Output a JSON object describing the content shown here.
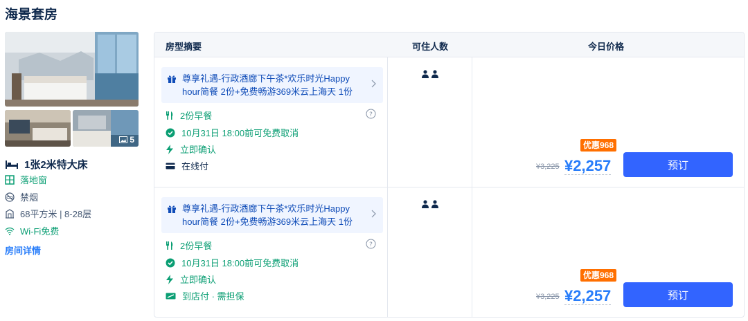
{
  "room": {
    "title": "海景套房",
    "photo_count": "5",
    "bed": "1张2米特大床",
    "facilities": {
      "window": "落地窗",
      "smoking": "禁烟",
      "area_floor": "68平方米 | 8-28层",
      "wifi": "Wi-Fi免费"
    },
    "detail_link": "房间详情"
  },
  "table": {
    "headers": {
      "summary": "房型摘要",
      "guests": "可住人数",
      "price": "今日价格"
    },
    "rows": [
      {
        "perk": "尊享礼遇-行政酒廊下午茶*欢乐时光Happy hour简餐 2份+免费畅游369米云上海天 1份",
        "breakfast": "2份早餐",
        "cancel": "10月31日 18:00前可免费取消",
        "confirm": "立即确认",
        "payment": "在线付",
        "guests": 2,
        "discount": "优惠968",
        "original_price": "¥3,225",
        "price": "¥2,257",
        "book_label": "预订"
      },
      {
        "perk": "尊享礼遇-行政酒廊下午茶*欢乐时光Happy hour简餐 2份+免费畅游369米云上海天 1份",
        "breakfast": "2份早餐",
        "cancel": "10月31日 18:00前可免费取消",
        "confirm": "立即确认",
        "payment": "到店付 · 需担保",
        "guests": 2,
        "discount": "优惠968",
        "original_price": "¥3,225",
        "price": "¥2,257",
        "book_label": "预订"
      }
    ]
  },
  "colors": {
    "accent": "#287dfa",
    "button": "#3264ff",
    "green": "#0a9e73",
    "discount": "#ff6f00"
  }
}
